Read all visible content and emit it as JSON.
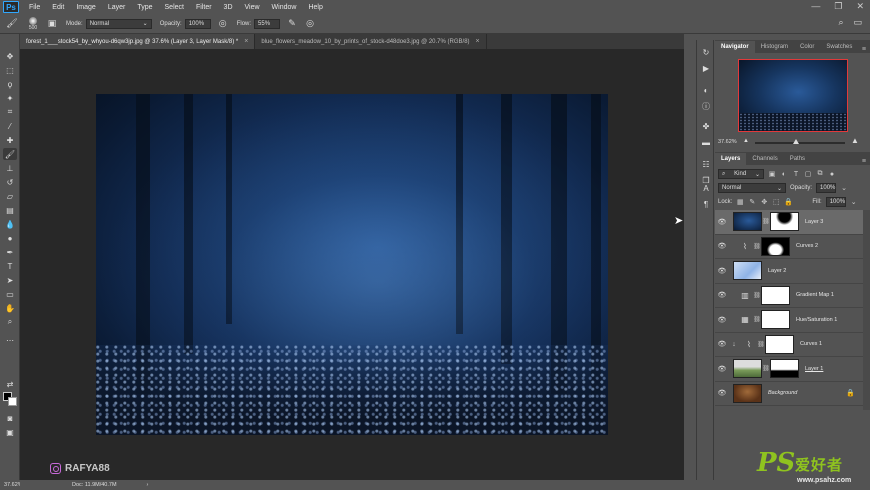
{
  "menubar": {
    "logo": "Ps",
    "items": [
      "File",
      "Edit",
      "Image",
      "Layer",
      "Type",
      "Select",
      "Filter",
      "3D",
      "View",
      "Window",
      "Help"
    ],
    "window_controls": [
      "—",
      "❐",
      "✕"
    ]
  },
  "options": {
    "brush_size": "500",
    "mode_label": "Mode:",
    "mode_value": "Normal",
    "opacity_label": "Opacity:",
    "opacity_value": "100%",
    "flow_label": "Flow:",
    "flow_value": "55%"
  },
  "tabs": [
    {
      "label": "forest_1___stock54_by_whyou-d6qw3jp.jpg @ 37.6% (Layer 3, Layer Mask/8) *",
      "close": "×"
    },
    {
      "label": "blue_flowers_meadow_10_by_prints_of_stock-d48doe3.jpg @ 20.7% (RGB/8)",
      "close": "×"
    }
  ],
  "canvas": {
    "watermark": "RAFYA88"
  },
  "status": {
    "zoom": "37.62%",
    "doc": "Doc: 11.9M/40.7M",
    "arrow": "›"
  },
  "navigator": {
    "tabs": [
      "Navigator",
      "Histogram",
      "Color",
      "Swatches"
    ],
    "zoom": "37.62%"
  },
  "layers": {
    "tabs": [
      "Layers",
      "Channels",
      "Paths"
    ],
    "filter_kind": "Kind",
    "blend_mode": "Normal",
    "opacity_label": "Opacity:",
    "opacity_value": "100%",
    "lock_label": "Lock:",
    "fill_label": "Fill:",
    "fill_value": "100%",
    "items": [
      {
        "name": "Layer 3"
      },
      {
        "name": "Curves 2"
      },
      {
        "name": "Layer 2"
      },
      {
        "name": "Gradient Map 1"
      },
      {
        "name": "Hue/Saturation 1"
      },
      {
        "name": "Curves 1"
      },
      {
        "name": "Layer 1"
      },
      {
        "name": "Background"
      }
    ]
  },
  "badge": {
    "ps": "PS",
    "cn": "爱好者",
    "url": "www.psahz.com"
  },
  "colors": {
    "accent_red": "#e3393a",
    "badge_green": "#8fc31f",
    "ps_blue": "#31a8ff"
  }
}
